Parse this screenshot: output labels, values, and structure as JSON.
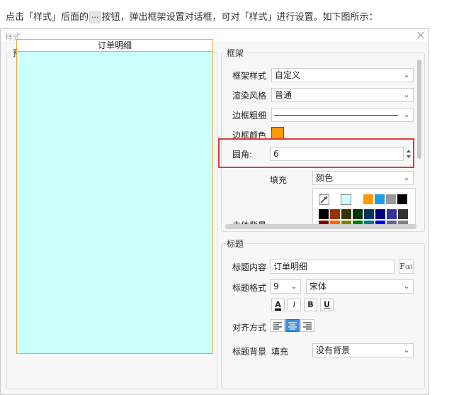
{
  "intro": {
    "before": "点击「样式」后面的",
    "dots": "···",
    "after": "按钮，弹出框架设置对话框，可对「样式」进行设置。如下图所示："
  },
  "dialog": {
    "title": "样式",
    "close": "×"
  },
  "preview": {
    "group_label": "预览",
    "header_text": "订单明细",
    "header_border_color": "#f0a830",
    "body_color": "#ccffff"
  },
  "frame": {
    "group_label": "框架",
    "style": {
      "label": "框架样式",
      "value": "自定义"
    },
    "render": {
      "label": "渲染风格",
      "value": "普通"
    },
    "border_width": {
      "label": "边框粗细"
    },
    "border_color": {
      "label": "边框颜色",
      "value": "#ff9900"
    },
    "radius": {
      "label": "圆角:",
      "value": "6"
    },
    "fill": {
      "label": "填充",
      "value": "颜色"
    },
    "bg_label": "主体背景",
    "swatches": [
      [
        "eyedropper",
        "#ccffff",
        "#ffffff",
        "#ff9900",
        "#1ca0e0",
        "#999999",
        "#000000"
      ],
      [
        "#000000",
        "#993300",
        "#333300",
        "#003300",
        "#003366",
        "#000080",
        "#333399",
        "#333333"
      ],
      [
        "#800000",
        "#ff6600",
        "#808000",
        "#008000",
        "#008080",
        "#0000ff",
        "#666699",
        "#808080"
      ]
    ]
  },
  "title": {
    "group_label": "标题",
    "content": {
      "label": "标题内容",
      "value": "订单明细"
    },
    "format": {
      "label": "标题格式",
      "size": "9",
      "font": "宋体"
    },
    "buttons": {
      "color": "A",
      "italic": "I",
      "bold": "B",
      "underline": "U"
    },
    "align_label": "对齐方式",
    "background": {
      "label": "标题背景",
      "fill_label": "填充",
      "value": "没有背景"
    }
  }
}
